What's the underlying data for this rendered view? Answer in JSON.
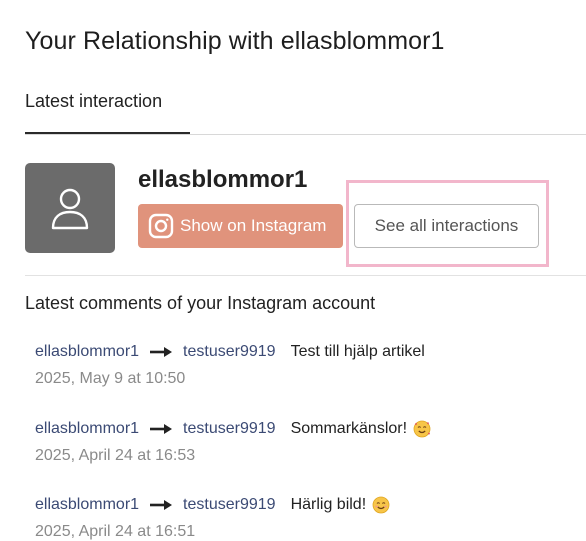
{
  "page": {
    "title": "Your Relationship with ellasblommor1"
  },
  "tabs": [
    {
      "label": "Latest interaction",
      "active": true
    }
  ],
  "profile": {
    "username": "ellasblommor1",
    "avatar_icon": "user-icon",
    "instagram_button": "Show on Instagram",
    "see_all_button": "See all interactions"
  },
  "comments_section": {
    "title": "Latest comments of your Instagram account",
    "comments": [
      {
        "from": "ellasblommor1",
        "to": "testuser9919",
        "text": "Test till hjälp artikel",
        "emoji": "",
        "date": "2025, May 9 at 10:50"
      },
      {
        "from": "ellasblommor1",
        "to": "testuser9919",
        "text": "Sommarkänslor!",
        "emoji": "smiling-face-hearts",
        "date": "2025, April 24 at 16:53"
      },
      {
        "from": "ellasblommor1",
        "to": "testuser9919",
        "text": "Härlig bild!",
        "emoji": "smiling-face",
        "date": "2025, April 24 at 16:51"
      }
    ]
  },
  "colors": {
    "instagram_button": "#e0937c",
    "highlight": "#f2b6cb",
    "username_link": "#3b4a74",
    "avatar_bg": "#6b6b6b"
  }
}
